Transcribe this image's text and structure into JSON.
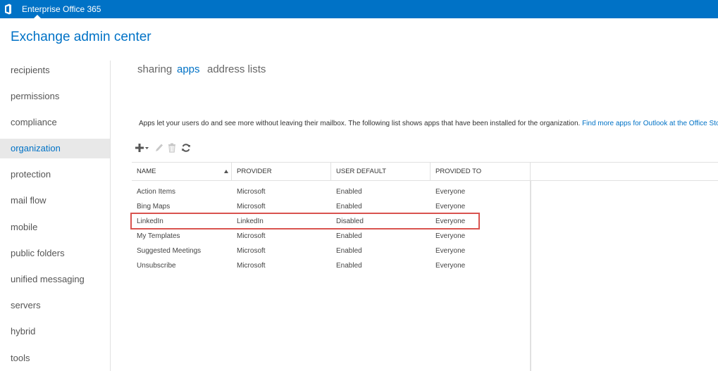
{
  "topbar": {
    "logo_icon": "office-logo-icon",
    "tabs": [
      "Enterprise",
      "Office 365"
    ],
    "active_tab": "Enterprise",
    "color": "#0072c6"
  },
  "app_title": "Exchange admin center",
  "sidebar": {
    "items": [
      {
        "label": "recipients"
      },
      {
        "label": "permissions"
      },
      {
        "label": "compliance management"
      },
      {
        "label": "organization",
        "active": true
      },
      {
        "label": "protection"
      },
      {
        "label": "mail flow"
      },
      {
        "label": "mobile"
      },
      {
        "label": "public folders"
      },
      {
        "label": "unified messaging"
      },
      {
        "label": "servers"
      },
      {
        "label": "hybrid"
      },
      {
        "label": "tools"
      }
    ]
  },
  "subtabs": [
    {
      "label": "sharing"
    },
    {
      "label": "apps",
      "active": true
    },
    {
      "label": "address lists"
    }
  ],
  "description": {
    "text": "Apps let your users do and see more without leaving their mailbox. The following list shows apps that have been installed for the organization. ",
    "link": "Find more apps for Outlook at the Office Store..."
  },
  "toolbar": {
    "icons": [
      "add-icon",
      "edit-icon",
      "delete-icon",
      "refresh-icon"
    ]
  },
  "table": {
    "columns": [
      "NAME",
      "PROVIDER",
      "USER DEFAULT",
      "PROVIDED TO"
    ],
    "sorted_column": "NAME",
    "sort_direction": "ascending",
    "rows": [
      [
        "Action Items",
        "Microsoft",
        "Enabled",
        "Everyone"
      ],
      [
        "Bing Maps",
        "Microsoft",
        "Enabled",
        "Everyone"
      ],
      [
        "LinkedIn",
        "LinkedIn",
        "Disabled",
        "Everyone"
      ],
      [
        "My Templates",
        "Microsoft",
        "Enabled",
        "Everyone"
      ],
      [
        "Suggested Meetings",
        "Microsoft",
        "Enabled",
        "Everyone"
      ],
      [
        "Unsubscribe",
        "Microsoft",
        "Enabled",
        "Everyone"
      ]
    ],
    "highlighted_row": "LinkedIn",
    "highlight_color": "#d9534f"
  }
}
